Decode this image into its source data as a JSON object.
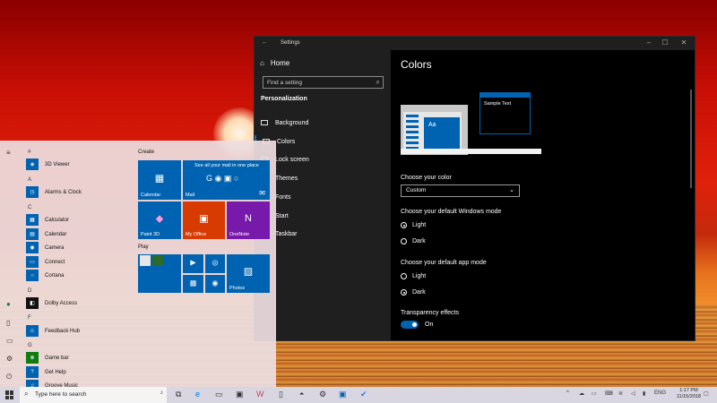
{
  "settings": {
    "window_title": "Settings",
    "controls": {
      "minimize": "–",
      "maximize": "☐",
      "close": "✕"
    },
    "home_label": "Home",
    "search_placeholder": "Find a setting",
    "section_title": "Personalization",
    "nav_items": [
      "Background",
      "Colors",
      "Lock screen",
      "Themes",
      "Fonts",
      "Start",
      "Taskbar"
    ],
    "page_title": "Colors",
    "preview_sample_text": "Sample Text",
    "preview_tile_text": "Aa",
    "choose_color_label": "Choose your color",
    "choose_color_value": "Custom",
    "windows_mode_label": "Choose your default Windows mode",
    "windows_mode_options": [
      "Light",
      "Dark"
    ],
    "windows_mode_selected": "Light",
    "app_mode_label": "Choose your default app mode",
    "app_mode_options": [
      "Light",
      "Dark"
    ],
    "app_mode_selected": "Dark",
    "transparency_label": "Transparency effects",
    "transparency_value": "On",
    "accent_color": "#0063b1"
  },
  "start_menu": {
    "sections": [
      {
        "letter": "#",
        "apps": [
          "3D Viewer"
        ]
      },
      {
        "letter": "A",
        "apps": [
          "Alarms & Clock"
        ]
      },
      {
        "letter": "C",
        "apps": [
          "Calculator",
          "Calendar",
          "Camera",
          "Connect",
          "Cortana"
        ]
      },
      {
        "letter": "D",
        "apps": [
          "Dolby Access"
        ]
      },
      {
        "letter": "F",
        "apps": [
          "Feedback Hub"
        ]
      },
      {
        "letter": "G",
        "apps": [
          "Game bar",
          "Get Help",
          "Groove Music"
        ]
      }
    ],
    "create_label": "Create",
    "play_label": "Play",
    "tiles": {
      "calendar": "Calendar",
      "mail": "Mail",
      "mail_banner": "See all your mail in one place",
      "paint3d": "Paint 3D",
      "myoffice": "My Office",
      "onenote": "OneNote",
      "photos": "Photos"
    }
  },
  "taskbar": {
    "search_placeholder": "Type here to search",
    "language": "ENG",
    "time": "1:17 PM",
    "date": "11/15/2018"
  }
}
